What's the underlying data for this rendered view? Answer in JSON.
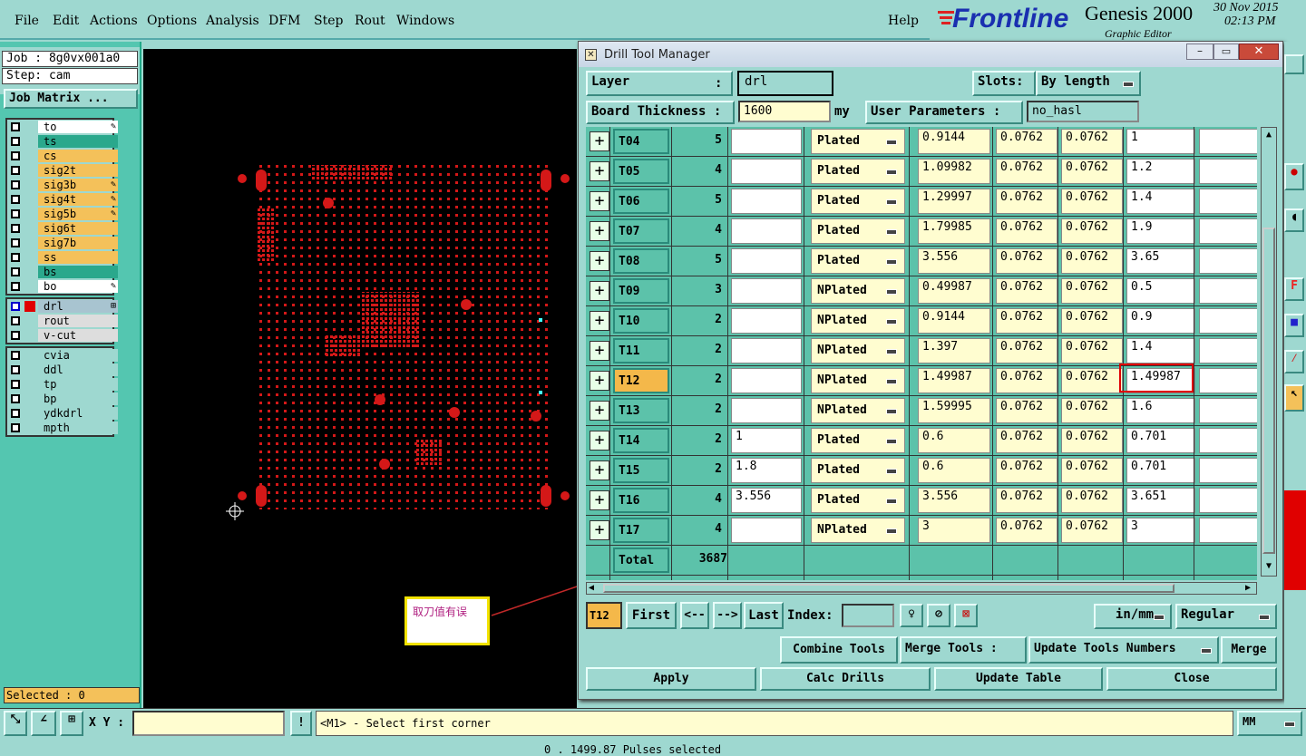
{
  "menu": [
    "File",
    "Edit",
    "Actions",
    "Options",
    "Analysis",
    "DFM",
    "Step",
    "Rout",
    "Windows"
  ],
  "help_label": "Help",
  "brand": {
    "logo": "Frontline",
    "product": "Genesis 2000",
    "subtitle": "Graphic Editor",
    "date": "30 Nov 2015",
    "time": "02:13 PM"
  },
  "job": {
    "job_line": "Job : 8g0vx001a0",
    "step_line": "Step: cam",
    "matrix_button": "Job Matrix ..."
  },
  "layers_board": [
    {
      "name": "to",
      "color": "#ffffff",
      "mark": "✎"
    },
    {
      "name": "ts",
      "color": "#2aa88c",
      "mark": ""
    },
    {
      "name": "cs",
      "color": "#f4c15a",
      "mark": ""
    },
    {
      "name": "sig2t",
      "color": "#f4c15a",
      "mark": ""
    },
    {
      "name": "sig3b",
      "color": "#f4c15a",
      "mark": "✎"
    },
    {
      "name": "sig4t",
      "color": "#f4c15a",
      "mark": "✎"
    },
    {
      "name": "sig5b",
      "color": "#f4c15a",
      "mark": "✎"
    },
    {
      "name": "sig6t",
      "color": "#f4c15a",
      "mark": ""
    },
    {
      "name": "sig7b",
      "color": "#f4c15a",
      "mark": ""
    },
    {
      "name": "ss",
      "color": "#f4c15a",
      "mark": ""
    },
    {
      "name": "bs",
      "color": "#2aa88c",
      "mark": ""
    },
    {
      "name": "bo",
      "color": "#ffffff",
      "mark": "✎"
    }
  ],
  "layers_drill": [
    {
      "name": "drl",
      "color": "#a8c4d0",
      "mark": "⊞"
    },
    {
      "name": "rout",
      "color": "#dddddd",
      "mark": ""
    },
    {
      "name": "v-cut",
      "color": "#dddddd",
      "mark": ""
    }
  ],
  "layers_misc": [
    {
      "name": "cvia",
      "color": "#9ed8d0"
    },
    {
      "name": "ddl",
      "color": "#9ed8d0"
    },
    {
      "name": "tp",
      "color": "#9ed8d0"
    },
    {
      "name": "bp",
      "color": "#9ed8d0"
    },
    {
      "name": "ydkdrl",
      "color": "#9ed8d0"
    },
    {
      "name": "mpth",
      "color": "#9ed8d0"
    }
  ],
  "selected_label": "Selected : 0",
  "note_text": "取刀值有误",
  "dialog": {
    "title": "Drill Tool Manager",
    "layer_label": "Layer",
    "layer_colon": ":",
    "layer_value": "drl",
    "slots_label": "Slots:",
    "slots_value": "By length",
    "thickness_label": "Board Thickness :",
    "thickness_value": "1600",
    "thickness_unit": "my",
    "user_params_label": "User Parameters :",
    "user_params_value": "no_hasl",
    "rows": [
      {
        "tool": "T04",
        "count": "5",
        "spec": "",
        "type": "Plated",
        "size": "0.9144",
        "tol_p": "0.0762",
        "tol_m": "0.0762",
        "finish": "1",
        "selected": false
      },
      {
        "tool": "T05",
        "count": "4",
        "spec": "",
        "type": "Plated",
        "size": "1.09982",
        "tol_p": "0.0762",
        "tol_m": "0.0762",
        "finish": "1.2",
        "selected": false
      },
      {
        "tool": "T06",
        "count": "5",
        "spec": "",
        "type": "Plated",
        "size": "1.29997",
        "tol_p": "0.0762",
        "tol_m": "0.0762",
        "finish": "1.4",
        "selected": false
      },
      {
        "tool": "T07",
        "count": "4",
        "spec": "",
        "type": "Plated",
        "size": "1.79985",
        "tol_p": "0.0762",
        "tol_m": "0.0762",
        "finish": "1.9",
        "selected": false
      },
      {
        "tool": "T08",
        "count": "5",
        "spec": "",
        "type": "Plated",
        "size": "3.556",
        "tol_p": "0.0762",
        "tol_m": "0.0762",
        "finish": "3.65",
        "selected": false
      },
      {
        "tool": "T09",
        "count": "3",
        "spec": "",
        "type": "NPlated",
        "size": "0.49987",
        "tol_p": "0.0762",
        "tol_m": "0.0762",
        "finish": "0.5",
        "selected": false
      },
      {
        "tool": "T10",
        "count": "2",
        "spec": "",
        "type": "NPlated",
        "size": "0.9144",
        "tol_p": "0.0762",
        "tol_m": "0.0762",
        "finish": "0.9",
        "selected": false
      },
      {
        "tool": "T11",
        "count": "2",
        "spec": "",
        "type": "NPlated",
        "size": "1.397",
        "tol_p": "0.0762",
        "tol_m": "0.0762",
        "finish": "1.4",
        "selected": false
      },
      {
        "tool": "T12",
        "count": "2",
        "spec": "",
        "type": "NPlated",
        "size": "1.49987",
        "tol_p": "0.0762",
        "tol_m": "0.0762",
        "finish": "1.49987",
        "selected": true
      },
      {
        "tool": "T13",
        "count": "2",
        "spec": "",
        "type": "NPlated",
        "size": "1.59995",
        "tol_p": "0.0762",
        "tol_m": "0.0762",
        "finish": "1.6",
        "selected": false
      },
      {
        "tool": "T14",
        "count": "2",
        "spec": "1",
        "type": "Plated",
        "size": "0.6",
        "tol_p": "0.0762",
        "tol_m": "0.0762",
        "finish": "0.701",
        "selected": false
      },
      {
        "tool": "T15",
        "count": "2",
        "spec": "1.8",
        "type": "Plated",
        "size": "0.6",
        "tol_p": "0.0762",
        "tol_m": "0.0762",
        "finish": "0.701",
        "selected": false
      },
      {
        "tool": "T16",
        "count": "4",
        "spec": "3.556",
        "type": "Plated",
        "size": "3.556",
        "tol_p": "0.0762",
        "tol_m": "0.0762",
        "finish": "3.651",
        "selected": false
      },
      {
        "tool": "T17",
        "count": "4",
        "spec": "",
        "type": "NPlated",
        "size": "3",
        "tol_p": "0.0762",
        "tol_m": "0.0762",
        "finish": "3",
        "selected": false
      }
    ],
    "total_label": "Total",
    "total_value": "3687",
    "nav": {
      "current": "T12",
      "first": "First",
      "prev": "<--",
      "next": "-->",
      "last": "Last",
      "index_label": "Index:",
      "units": "in/mm",
      "mode": "Regular"
    },
    "combine_label": "Combine Tools",
    "merge_label": "Merge Tools :",
    "update_numbers": "Update Tools Numbers",
    "merge_btn": "Merge",
    "apply": "Apply",
    "calc": "Calc Drills",
    "update_table": "Update Table",
    "close": "Close"
  },
  "status": {
    "xy_label": "X Y :",
    "xy_value": "",
    "message": "<M1> - Select first corner",
    "units": "MM",
    "footer": "0 . 1499.87 Pulses selected"
  },
  "colors": {
    "teal": "#9ed8d0",
    "panel": "#54c6b0",
    "highlight_red": "#e00000",
    "pcb_red": "#d41818",
    "selected_orange": "#f4b84a"
  }
}
